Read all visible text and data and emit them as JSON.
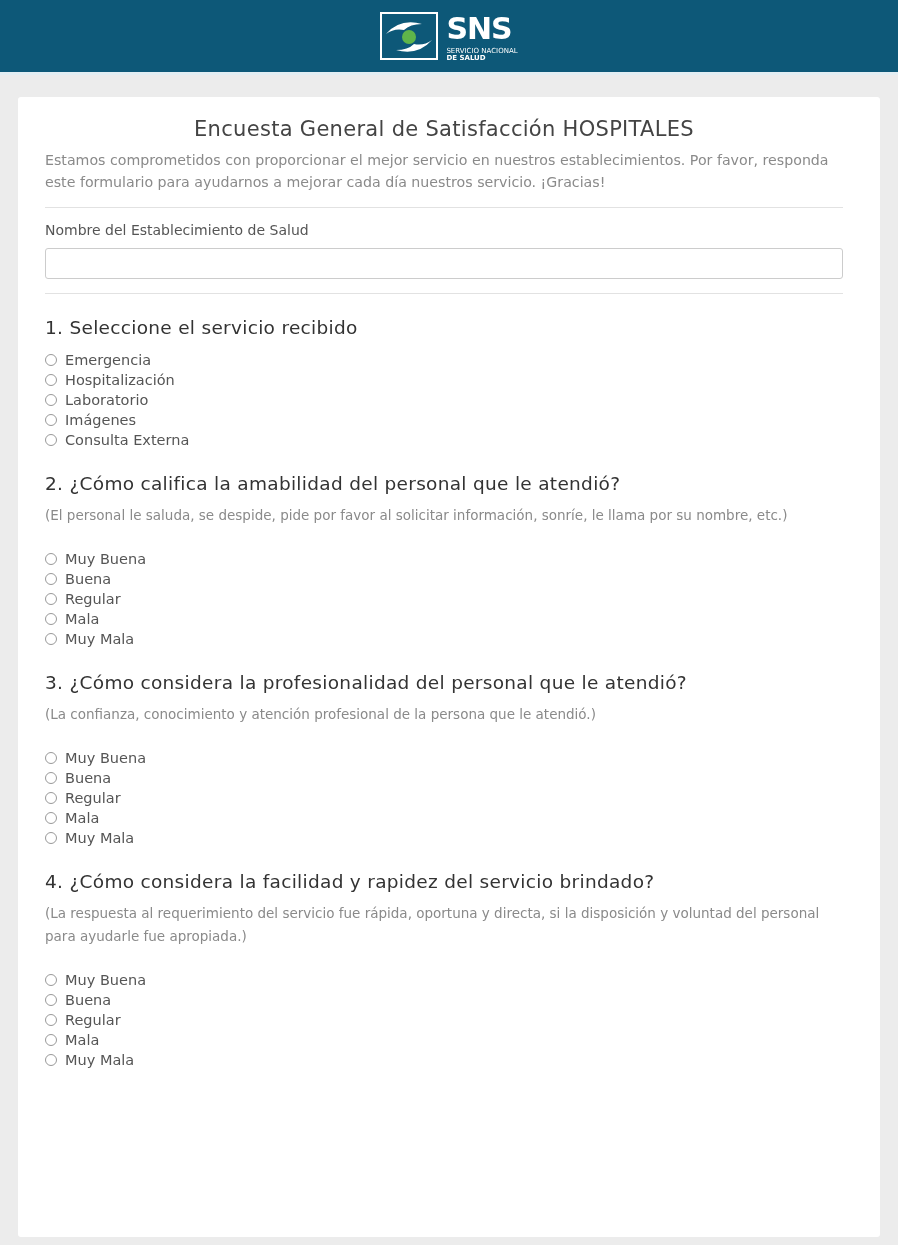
{
  "header": {
    "logo": {
      "acronym": "SNS",
      "name_line_1": "SERVICIO NACIONAL",
      "name_line_2": "DE SALUD"
    }
  },
  "survey": {
    "title": "Encuesta General de Satisfacción HOSPITALES",
    "description": "Estamos comprometidos con proporcionar el mejor servicio en nuestros establecimientos. Por favor, responda este formulario para ayudarnos a mejorar cada día nuestros servicio. ¡Gracias!",
    "facility_field": {
      "label": "Nombre del Establecimiento de Salud"
    },
    "questions": [
      {
        "title": "1. Seleccione el servicio recibido",
        "options": [
          {
            "label": "Emergencia",
            "selected": false
          },
          {
            "label": "Hospitalización",
            "selected": false
          },
          {
            "label": "Laboratorio",
            "selected": false
          },
          {
            "label": "Imágenes",
            "selected": false
          },
          {
            "label": "Consulta Externa",
            "selected": false
          }
        ]
      },
      {
        "title": "2. ¿Cómo califica la amabilidad del personal que le atendió?",
        "note": "(El personal le saluda, se despide, pide por favor al solicitar información, sonríe, le llama por su nombre, etc.)",
        "options": [
          {
            "label": "Muy Buena",
            "selected": false
          },
          {
            "label": "Buena",
            "selected": false
          },
          {
            "label": "Regular",
            "selected": false
          },
          {
            "label": "Mala",
            "selected": false
          },
          {
            "label": "Muy Mala",
            "selected": false
          }
        ]
      },
      {
        "title": "3. ¿Cómo considera la profesionalidad del personal que le atendió?",
        "note": "(La confianza, conocimiento y atención profesional de la persona que le atendió.)",
        "options": [
          {
            "label": "Muy Buena",
            "selected": false
          },
          {
            "label": "Buena",
            "selected": false
          },
          {
            "label": "Regular",
            "selected": false
          },
          {
            "label": "Mala",
            "selected": false
          },
          {
            "label": "Muy Mala",
            "selected": false
          }
        ]
      },
      {
        "title": "4. ¿Cómo considera la facilidad y rapidez del servicio brindado?",
        "note": "(La respuesta al requerimiento del servicio fue rápida, oportuna y directa, si la disposición y voluntad del personal para ayudarle fue apropiada.)",
        "options": [
          {
            "label": "Muy Buena",
            "selected": false
          },
          {
            "label": "Buena",
            "selected": false
          },
          {
            "label": "Regular",
            "selected": false
          },
          {
            "label": "Mala",
            "selected": false
          },
          {
            "label": "Muy Mala",
            "selected": false
          }
        ]
      }
    ]
  }
}
